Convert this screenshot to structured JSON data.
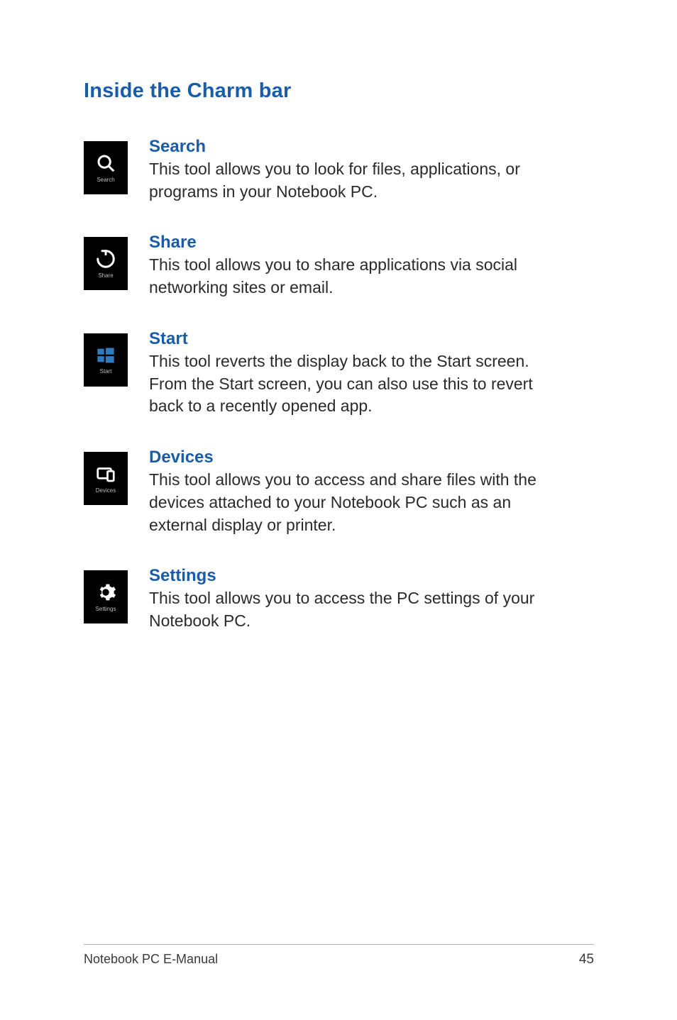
{
  "section_title": "Inside the Charm bar",
  "entries": [
    {
      "icon_name": "search-icon",
      "icon_label": "Search",
      "title": "Search",
      "desc": "This tool allows you to look for files, applications, or programs in your Notebook PC."
    },
    {
      "icon_name": "share-icon",
      "icon_label": "Share",
      "title": "Share",
      "desc": "This tool allows you to share applications via social networking sites or email."
    },
    {
      "icon_name": "start-icon",
      "icon_label": "Start",
      "title": "Start",
      "desc": "This tool reverts the display back to the Start screen. From the Start screen, you can also use this to revert back to a recently opened app."
    },
    {
      "icon_name": "devices-icon",
      "icon_label": "Devices",
      "title": "Devices",
      "desc": "This tool allows you to access and share files with the devices attached to your Notebook PC such as an external display or printer."
    },
    {
      "icon_name": "settings-icon",
      "icon_label": "Settings",
      "title": "Settings",
      "desc": "This tool allows you to access the PC settings of your Notebook PC."
    }
  ],
  "footer": {
    "left": "Notebook PC E-Manual",
    "right": "45"
  }
}
